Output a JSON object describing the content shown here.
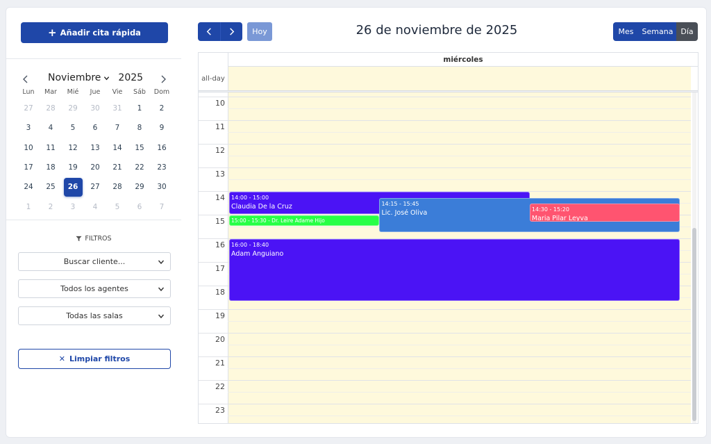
{
  "sidebar": {
    "quick_add_label": "Añadir cita rápida",
    "mini_calendar": {
      "month": "Noviembre",
      "year": "2025",
      "weekdays": [
        "Lun",
        "Mar",
        "Mié",
        "Jue",
        "Vie",
        "Sáb",
        "Dom"
      ],
      "days": [
        {
          "d": "27",
          "out": true
        },
        {
          "d": "28",
          "out": true
        },
        {
          "d": "29",
          "out": true
        },
        {
          "d": "30",
          "out": true
        },
        {
          "d": "31",
          "out": true
        },
        {
          "d": "1"
        },
        {
          "d": "2"
        },
        {
          "d": "3"
        },
        {
          "d": "4"
        },
        {
          "d": "5"
        },
        {
          "d": "6"
        },
        {
          "d": "7"
        },
        {
          "d": "8"
        },
        {
          "d": "9"
        },
        {
          "d": "10"
        },
        {
          "d": "11"
        },
        {
          "d": "12"
        },
        {
          "d": "13"
        },
        {
          "d": "14"
        },
        {
          "d": "15"
        },
        {
          "d": "16"
        },
        {
          "d": "17"
        },
        {
          "d": "18"
        },
        {
          "d": "19"
        },
        {
          "d": "20"
        },
        {
          "d": "21"
        },
        {
          "d": "22"
        },
        {
          "d": "23"
        },
        {
          "d": "24"
        },
        {
          "d": "25"
        },
        {
          "d": "26",
          "selected": true
        },
        {
          "d": "27"
        },
        {
          "d": "28"
        },
        {
          "d": "29"
        },
        {
          "d": "30"
        },
        {
          "d": "1",
          "out": true
        },
        {
          "d": "2",
          "out": true
        },
        {
          "d": "3",
          "out": true
        },
        {
          "d": "4",
          "out": true
        },
        {
          "d": "5",
          "out": true
        },
        {
          "d": "6",
          "out": true
        },
        {
          "d": "7",
          "out": true
        }
      ]
    },
    "filters": {
      "title": "FILTROS",
      "client_search": "Buscar cliente...",
      "agents": "Todos los agentes",
      "rooms": "Todas las salas",
      "clear_label": "Limpiar filtros"
    }
  },
  "toolbar": {
    "today_label": "Hoy",
    "title": "26 de noviembre de 2025",
    "views": {
      "month": "Mes",
      "week": "Semana",
      "day": "Día"
    },
    "active_view": "day"
  },
  "calendar": {
    "day_header": "miércoles",
    "allday_label": "all-day",
    "hours": [
      "10",
      "11",
      "12",
      "13",
      "14",
      "15",
      "16",
      "17",
      "18",
      "19",
      "20",
      "21",
      "22",
      "23"
    ],
    "events": [
      {
        "time": "14:00 - 15:00",
        "title": "Claudia De la Cruz",
        "start": 14.0,
        "end": 15.0,
        "lane_start": 0.0,
        "lane_end": 0.65,
        "color": "#4b13f5"
      },
      {
        "time": "14:15 - 15:45",
        "title": "Lic. José Oliva",
        "start": 14.25,
        "end": 15.75,
        "lane_start": 0.325,
        "lane_end": 0.975,
        "color": "#3b7dd8"
      },
      {
        "time": "14:30 - 15:20",
        "title": "Maria Pilar Leyva",
        "start": 14.5,
        "end": 15.33,
        "lane_start": 0.65,
        "lane_end": 0.975,
        "color": "#ff5470"
      },
      {
        "time": "15:00 - 15:30",
        "title": "Dr. Leire Adame Hijo",
        "start": 15.0,
        "end": 15.5,
        "lane_start": 0.0,
        "lane_end": 0.325,
        "color": "#27ff45",
        "inline": true
      },
      {
        "time": "16:00 - 18:40",
        "title": "Adam Anguiano",
        "start": 16.0,
        "end": 18.67,
        "lane_start": 0.0,
        "lane_end": 0.975,
        "color": "#4b13f5"
      }
    ]
  },
  "colors": {
    "primary": "#1f47a8",
    "allday_bg": "#fef9dc"
  }
}
